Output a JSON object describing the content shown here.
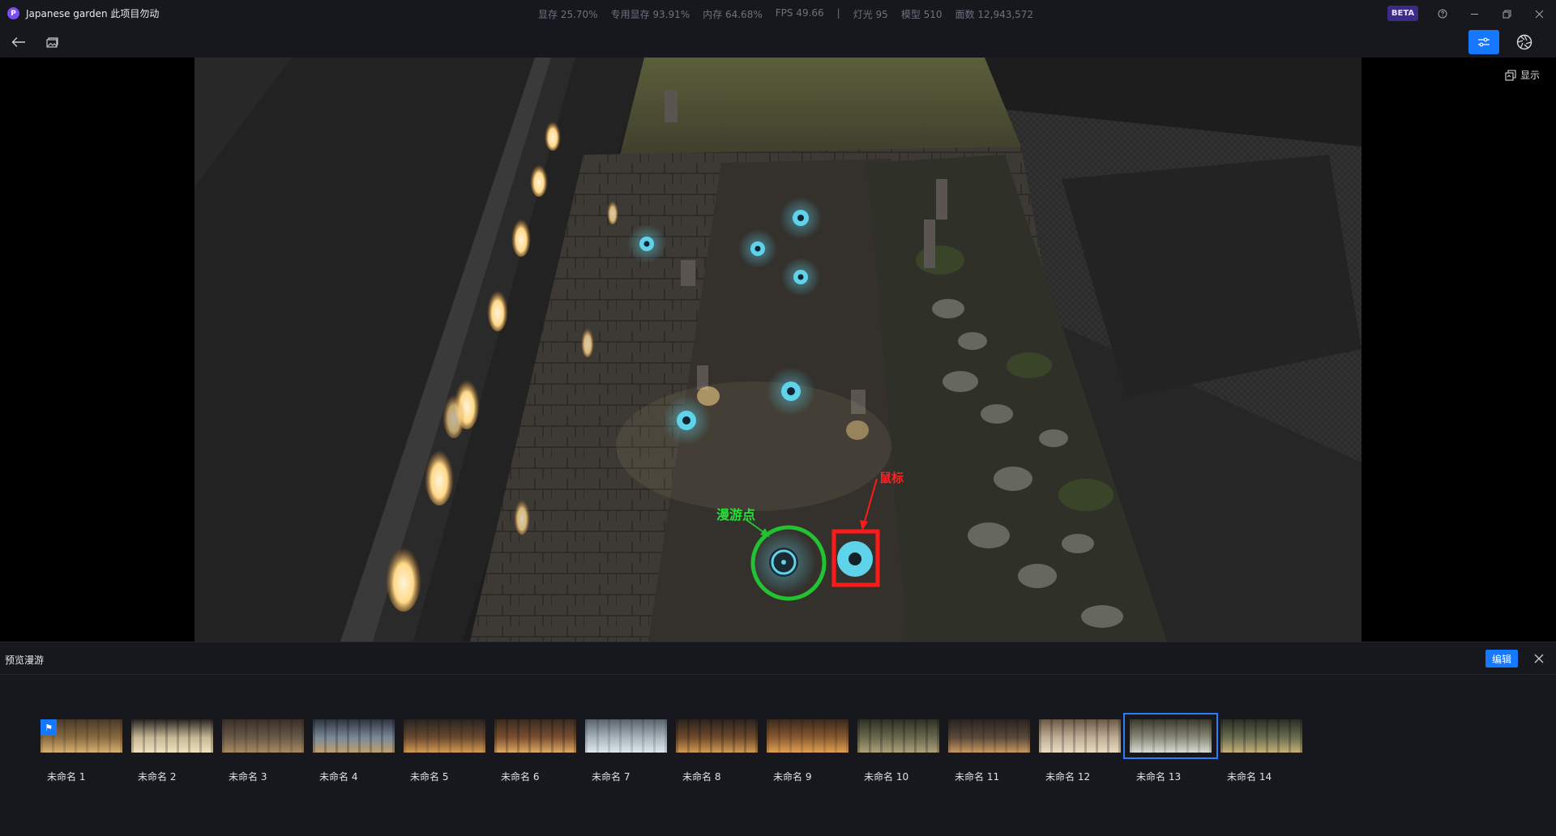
{
  "app": {
    "logo_letter": "P",
    "title": "Japanese garden 此项目勿动"
  },
  "stats": {
    "vram": "显存 25.70%",
    "dedicated_vram": "专用显存 93.91%",
    "memory": "内存 64.68%",
    "fps": "FPS 49.66",
    "separator": "|",
    "lights": "灯光 95",
    "models": "模型 510",
    "faces": "面数 12,943,572"
  },
  "beta_label": "BETA",
  "icons": {
    "help": "help-icon",
    "minimize": "minimize-icon",
    "restore": "restore-icon",
    "close": "close-icon",
    "back": "arrow-left-icon",
    "image": "image-icon",
    "settings": "sliders-icon",
    "aperture": "aperture-icon",
    "display": "layers-icon"
  },
  "viewport": {
    "display_label": "显示",
    "annotations": {
      "roam_point_label": "漫游点",
      "mouse_label": "鼠标"
    }
  },
  "panel": {
    "title": "预览漫游",
    "edit_label": "编辑",
    "flag_glyph": "⚑",
    "selected_index": 13,
    "thumbnails": [
      {
        "label": "未命名 1"
      },
      {
        "label": "未命名 2"
      },
      {
        "label": "未命名 3"
      },
      {
        "label": "未命名 4"
      },
      {
        "label": "未命名 5"
      },
      {
        "label": "未命名 6"
      },
      {
        "label": "未命名 7"
      },
      {
        "label": "未命名 8"
      },
      {
        "label": "未命名 9"
      },
      {
        "label": "未命名 10"
      },
      {
        "label": "未命名 11"
      },
      {
        "label": "未命名 12"
      },
      {
        "label": "未命名 13"
      },
      {
        "label": "未命名 14"
      }
    ]
  },
  "colors": {
    "accent": "#1677ff",
    "beta_bg": "#3b2a8a",
    "roam_point_marker": "#22c232",
    "mouse_marker": "#ff1a1a",
    "waypoint_glow": "#5fd3ea"
  }
}
